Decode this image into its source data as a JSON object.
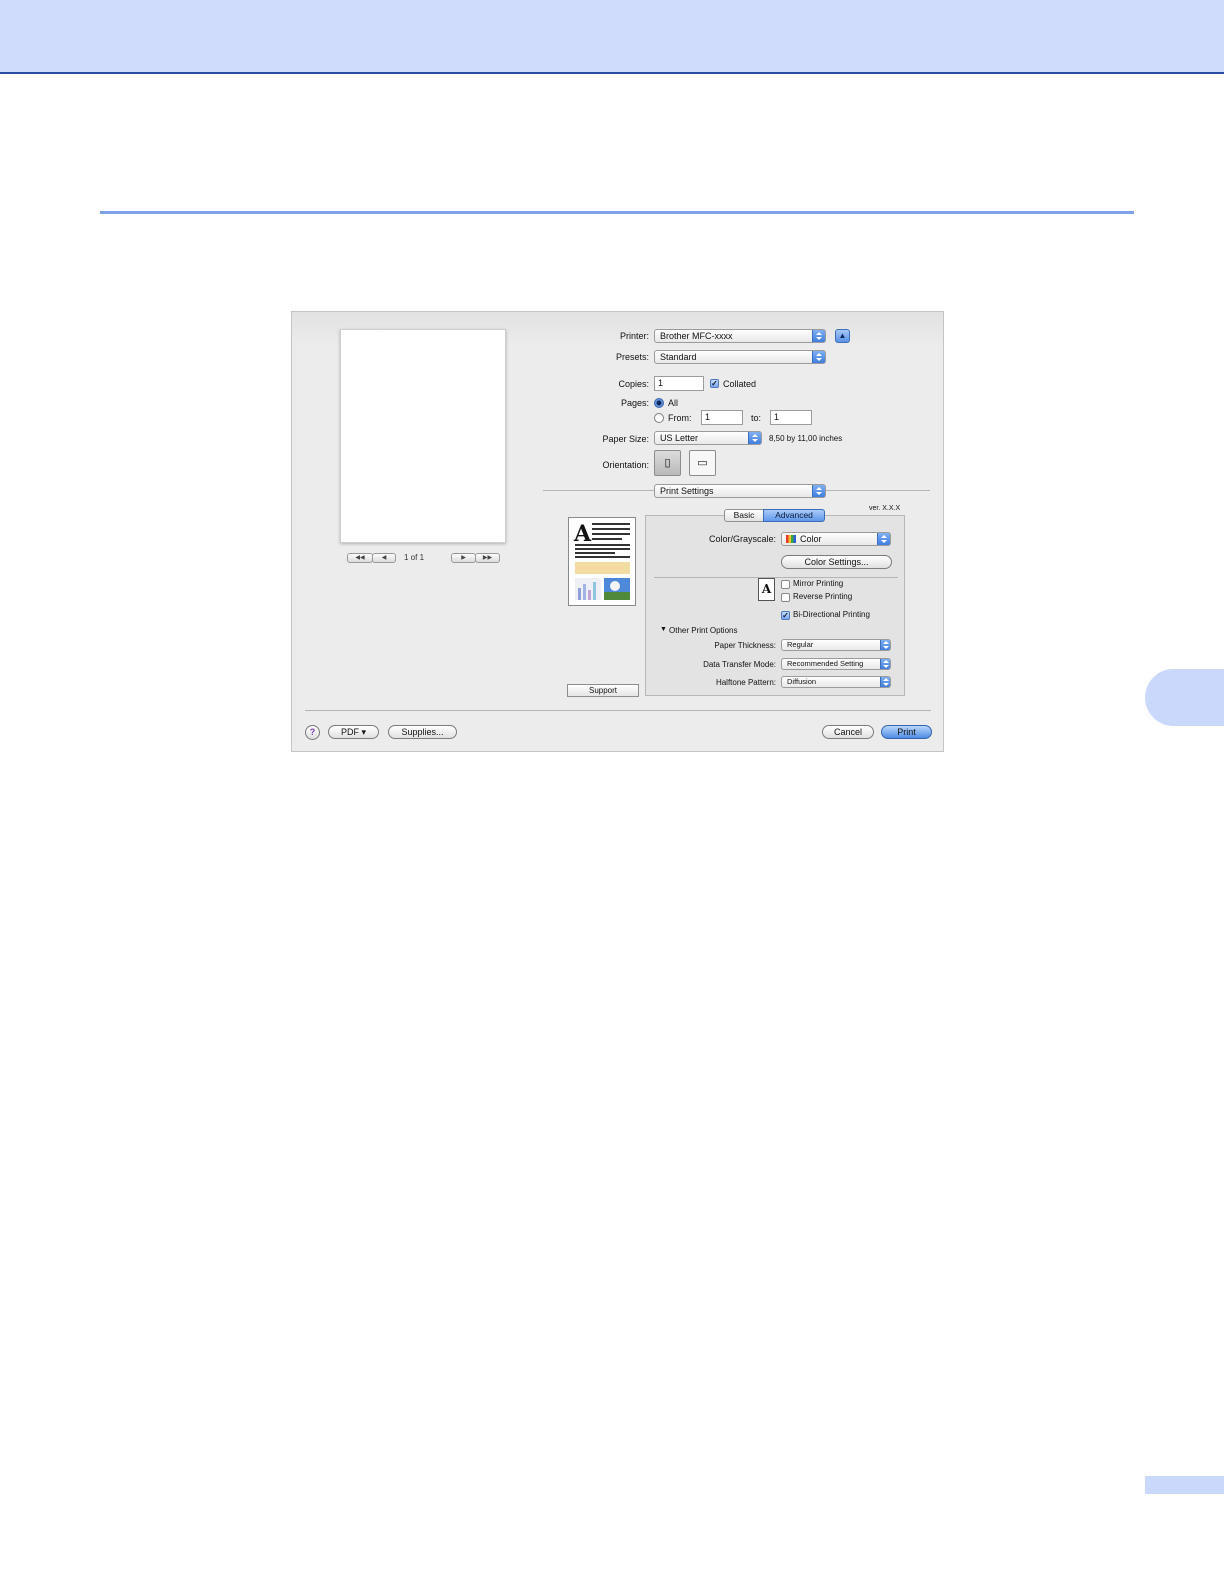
{
  "dialog": {
    "printer": {
      "label": "Printer:",
      "value": "Brother MFC-xxxx"
    },
    "presets": {
      "label": "Presets:",
      "value": "Standard"
    },
    "copies": {
      "label": "Copies:",
      "value": "1",
      "collated_label": "Collated",
      "collated_checked": true
    },
    "pages": {
      "label": "Pages:",
      "all_label": "All",
      "from_label": "From:",
      "from_value": "1",
      "to_label": "to:",
      "to_value": "1",
      "selected": "All"
    },
    "paper_size": {
      "label": "Paper Size:",
      "value": "US Letter",
      "dimensions": "8,50 by 11,00 inches"
    },
    "orientation": {
      "label": "Orientation:",
      "selected": "portrait"
    },
    "section": {
      "value": "Print Settings"
    },
    "preview": {
      "page_count": "1 of 1",
      "first_icon": "◀◀",
      "prev_icon": "◀",
      "next_icon": "▶",
      "last_icon": "▶▶"
    },
    "version": "ver. X.X.X",
    "tabs": [
      {
        "label": "Basic",
        "active": false
      },
      {
        "label": "Advanced",
        "active": true
      }
    ],
    "color_grayscale": {
      "label": "Color/Grayscale:",
      "value": "Color"
    },
    "color_settings_button": "Color Settings...",
    "options": [
      {
        "label": "Mirror Printing",
        "checked": false
      },
      {
        "label": "Reverse Printing",
        "checked": false
      },
      {
        "label": "Bi-Directional Printing",
        "checked": true
      }
    ],
    "other_options": {
      "disclosure_label": "Other Print Options",
      "paper_thickness": {
        "label": "Paper Thickness:",
        "value": "Regular"
      },
      "data_transfer_mode": {
        "label": "Data Transfer Mode:",
        "value": "Recommended Setting"
      },
      "halftone_pattern": {
        "label": "Halftone Pattern:",
        "value": "Diffusion"
      }
    },
    "support_button": "Support",
    "footer": {
      "help_glyph": "?",
      "pdf_button": "PDF ▾",
      "supplies_button": "Supplies...",
      "cancel_button": "Cancel",
      "print_button": "Print"
    }
  }
}
